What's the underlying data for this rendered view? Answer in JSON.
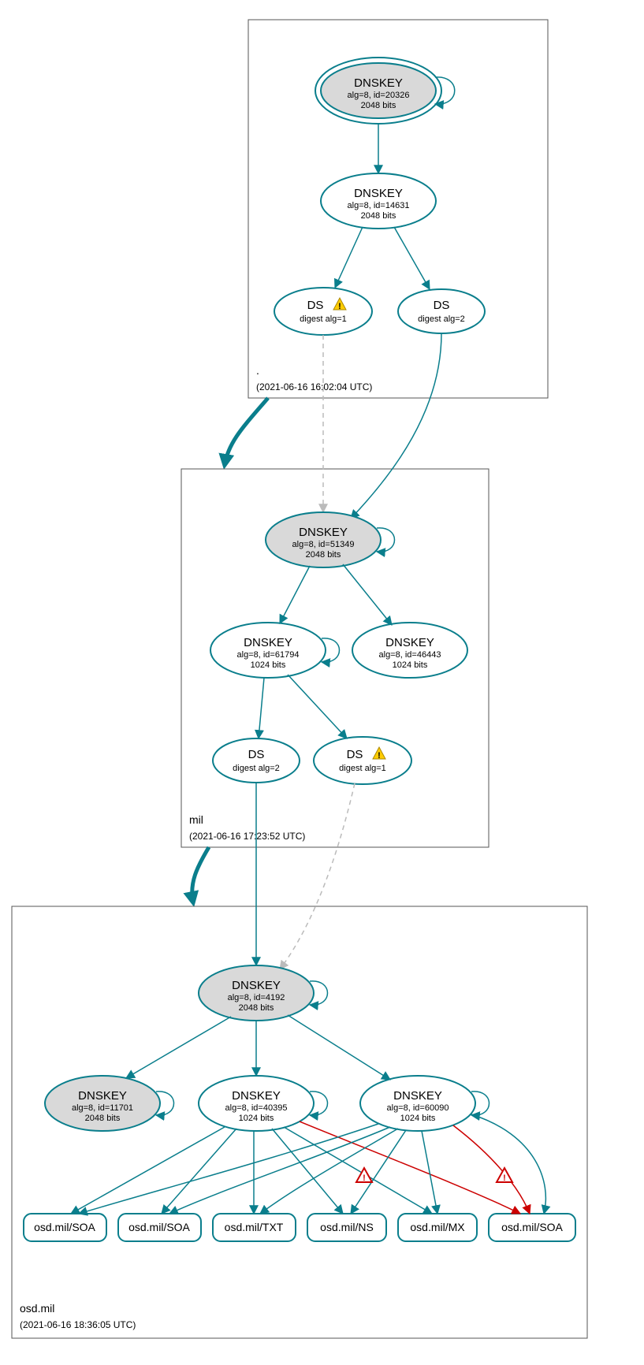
{
  "zones": {
    "root": {
      "label": ".",
      "timestamp": "(2021-06-16 16:02:04 UTC)"
    },
    "mil": {
      "label": "mil",
      "timestamp": "(2021-06-16 17:23:52 UTC)"
    },
    "osd": {
      "label": "osd.mil",
      "timestamp": "(2021-06-16 18:36:05 UTC)"
    }
  },
  "nodes": {
    "root_ksk": {
      "title": "DNSKEY",
      "line2": "alg=8, id=20326",
      "line3": "2048 bits"
    },
    "root_zsk": {
      "title": "DNSKEY",
      "line2": "alg=8, id=14631",
      "line3": "2048 bits"
    },
    "root_ds1": {
      "title": "DS",
      "line2": "digest alg=1"
    },
    "root_ds2": {
      "title": "DS",
      "line2": "digest alg=2"
    },
    "mil_ksk": {
      "title": "DNSKEY",
      "line2": "alg=8, id=51349",
      "line3": "2048 bits"
    },
    "mil_z1": {
      "title": "DNSKEY",
      "line2": "alg=8, id=61794",
      "line3": "1024 bits"
    },
    "mil_z2": {
      "title": "DNSKEY",
      "line2": "alg=8, id=46443",
      "line3": "1024 bits"
    },
    "mil_ds2": {
      "title": "DS",
      "line2": "digest alg=2"
    },
    "mil_ds1": {
      "title": "DS",
      "line2": "digest alg=1"
    },
    "osd_ksk": {
      "title": "DNSKEY",
      "line2": "alg=8, id=4192",
      "line3": "2048 bits"
    },
    "osd_k2": {
      "title": "DNSKEY",
      "line2": "alg=8, id=11701",
      "line3": "2048 bits"
    },
    "osd_z1": {
      "title": "DNSKEY",
      "line2": "alg=8, id=40395",
      "line3": "1024 bits"
    },
    "osd_z2": {
      "title": "DNSKEY",
      "line2": "alg=8, id=60090",
      "line3": "1024 bits"
    }
  },
  "records": {
    "r1": "osd.mil/SOA",
    "r2": "osd.mil/SOA",
    "r3": "osd.mil/TXT",
    "r4": "osd.mil/NS",
    "r5": "osd.mil/MX",
    "r6": "osd.mil/SOA"
  }
}
